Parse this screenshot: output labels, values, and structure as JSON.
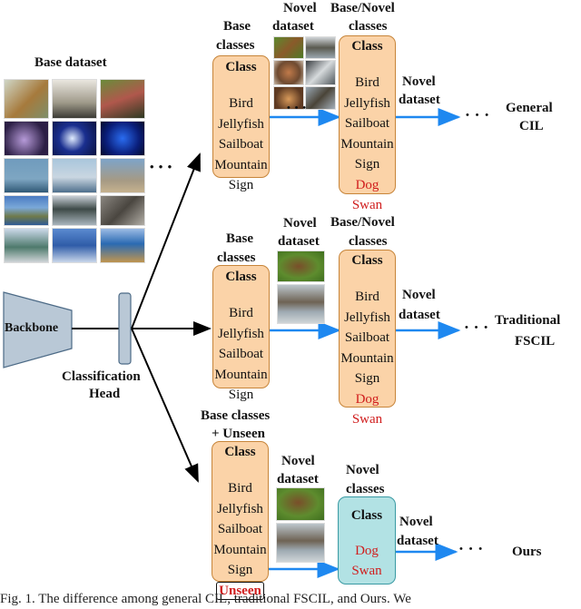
{
  "figure": {
    "base_dataset_label": "Base dataset",
    "base_dataset_images": [
      [
        "robin bird",
        "bird on bath",
        "finch bird"
      ],
      [
        "purple jellyfish",
        "white jellyfish",
        "blue jellyfish"
      ],
      [
        "sailboat",
        "sailboat lighthouse",
        "sailboat beach"
      ],
      [
        "coastal cliff",
        "cliffs sea",
        "rocky mountain"
      ],
      [
        "street sign",
        "street sign pole",
        "street sign sky"
      ]
    ],
    "ellipsis": "• • •",
    "backbone_label": "Backbone",
    "head_label_line1": "Classification",
    "head_label_line2": "Head",
    "rows": [
      {
        "name": "General CIL",
        "base_label_line1": "Base",
        "base_label_line2": "classes",
        "base_box": {
          "title": "Class",
          "items": [
            "Bird",
            "Jellyfish",
            "Sailboat",
            "Mountain",
            "Sign"
          ]
        },
        "novel_label_line1": "Novel",
        "novel_label_line2": "dataset",
        "novel_images": [
          "dog grass",
          "geese water",
          "poodle",
          "bird splash",
          "puppy",
          "duck"
        ],
        "combined_label_line1": "Base/Novel",
        "combined_label_line2": "classes",
        "combined_box": {
          "title": "Class",
          "items": [
            "Bird",
            "Jellyfish",
            "Sailboat",
            "Mountain",
            "Sign"
          ],
          "novel_items": [
            "Dog",
            "Swan"
          ]
        },
        "next_label_line1": "Novel",
        "next_label_line2": "dataset",
        "method_line1": "General",
        "method_line2": "CIL"
      },
      {
        "name": "Traditional FSCIL",
        "base_label_line1": "Base",
        "base_label_line2": "classes",
        "base_box": {
          "title": "Class",
          "items": [
            "Bird",
            "Jellyfish",
            "Sailboat",
            "Mountain",
            "Sign"
          ]
        },
        "novel_label_line1": "Novel",
        "novel_label_line2": "dataset",
        "novel_images": [
          "dog grass",
          "goose water"
        ],
        "combined_label_line1": "Base/Novel",
        "combined_label_line2": "classes",
        "combined_box": {
          "title": "Class",
          "items": [
            "Bird",
            "Jellyfish",
            "Sailboat",
            "Mountain",
            "Sign"
          ],
          "novel_items": [
            "Dog",
            "Swan"
          ]
        },
        "next_label_line1": "Novel",
        "next_label_line2": "dataset",
        "method_line1": "Traditional",
        "method_line2": "FSCIL"
      },
      {
        "name": "Ours",
        "base_label_line1": "Base classes",
        "base_label_line2": "+ Unseen",
        "base_box": {
          "title": "Class",
          "items": [
            "Bird",
            "Jellyfish",
            "Sailboat",
            "Mountain",
            "Sign"
          ],
          "unseen": "Unseen"
        },
        "novel_label_line1": "Novel",
        "novel_label_line2": "dataset",
        "novel_images": [
          "dog grass",
          "goose water"
        ],
        "combined_label_line1": "Novel",
        "combined_label_line2": "classes",
        "combined_box": {
          "title": "Class",
          "novel_items": [
            "Dog",
            "Swan"
          ]
        },
        "next_label_line1": "Novel",
        "next_label_line2": "dataset",
        "method_line1": "Ours"
      }
    ],
    "caption": "Fig. 1.  The difference among general CIL, traditional FSCIL, and Ours. We",
    "colors": {
      "class_box_fill": "#fbd3a8",
      "class_box_border": "#c7853a",
      "novel_box_fill": "#b2e2e4",
      "novel_box_border": "#3a9aa3",
      "flow_arrow": "#1e88f0",
      "novel_class_text": "#d01d1d",
      "backbone_fill": "#b9c8d6"
    }
  }
}
